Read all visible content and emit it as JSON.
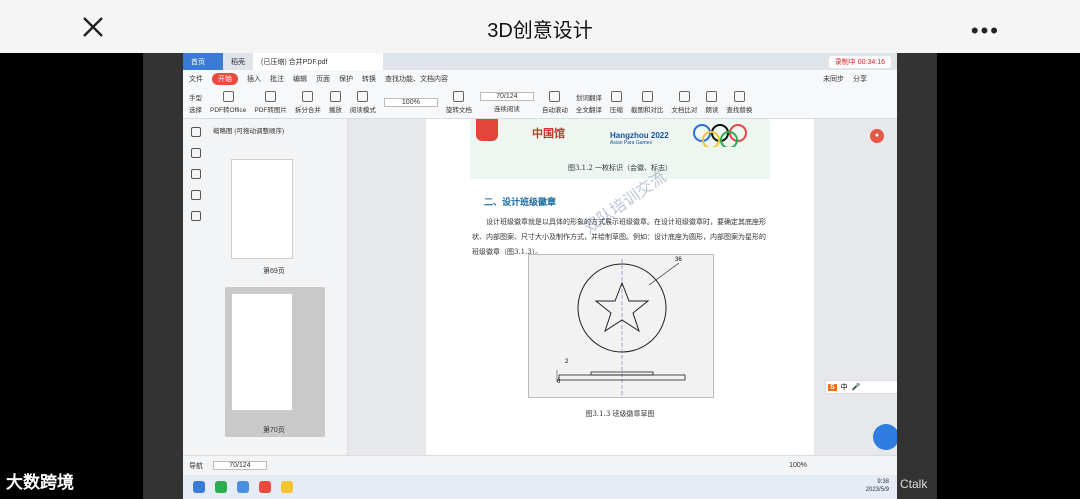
{
  "app": {
    "title": "3D创意设计"
  },
  "tabs": {
    "home": "首页",
    "shell": "稻壳",
    "doc": "(已压缩) 合并PDF.pdf",
    "recording": "录制中 00:34:16"
  },
  "menu": [
    "文件",
    "开始",
    "插入",
    "批注",
    "编辑",
    "页面",
    "保护",
    "转换",
    "查找功能、文档内容",
    "未同步",
    "分享"
  ],
  "toolbar": {
    "hand": "手型",
    "select": "选择",
    "pdf_office": "PDF转Office",
    "pdf_image": "PDF转图片",
    "split": "拆分合并",
    "play": "播放",
    "read": "阅读模式",
    "zoom": "100%",
    "rotate": "旋转文档",
    "page": "70/124",
    "single": "单页",
    "double": "双页",
    "continuous": "连续阅读",
    "auto_scroll": "自动滚动",
    "translate": "划词翻译",
    "full_translate": "全文翻译",
    "compress": "压缩",
    "screenshot": "截图和对比",
    "compare": "文档比对",
    "tts": "朗读",
    "find_replace": "查找替换"
  },
  "sidebar": {
    "header": "缩略图 (可拖动调整顺序)",
    "page69": "第69页",
    "page70": "第70页"
  },
  "document": {
    "brand": "中国馆",
    "hz": "Hangzhou 2022",
    "hz_sub": "Asian Para Games",
    "cap1": "图3.1.2   一枚标识（会徽、标志）",
    "heading": "二、设计班级徽章",
    "body": "设计班级徽章就是以具体的形象的方式展示班级徽章。在设计班级徽章时，要确定其底座形状、内部图案、尺寸大小及制作方式，并绘制草图。例如：设计底座为圆形，内部图案为星形的班级徽章（图3.1.3）。",
    "dim36": "36",
    "dim2": "2",
    "dim6": "6",
    "cap2": "图3.1.3   班级徽章草图",
    "watermark": "双队培训交流"
  },
  "statusbar": {
    "nav": "导航",
    "page": "70/124",
    "zoom": "100%"
  },
  "ime": {
    "label": "中"
  },
  "clock": {
    "time": "9:38",
    "date": "2023/5/9"
  },
  "watermarks": {
    "left": "大数跨境",
    "right": "Ctalk"
  },
  "colors": {
    "accent": "#e94b3c",
    "blue": "#3a7bd5"
  }
}
